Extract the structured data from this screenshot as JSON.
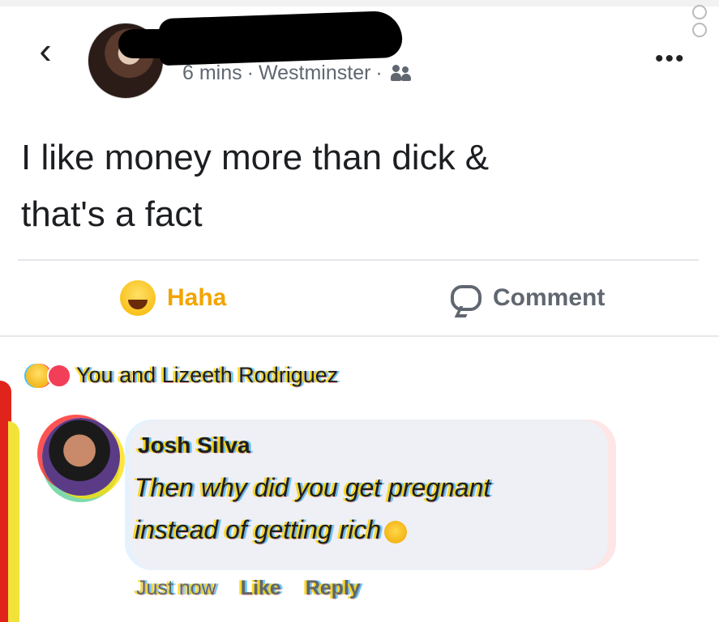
{
  "header": {
    "back_icon": "chevron-left-icon",
    "meta_time": "6 mins",
    "meta_sep": "·",
    "meta_location": "Westminster",
    "meta_sep2": "·",
    "audience_icon": "friends-icon",
    "more_label": "•••"
  },
  "post": {
    "text_line1": "I like money more than dick &",
    "text_line2": "that's a fact"
  },
  "actions": {
    "reaction_label": "Haha",
    "reaction_color": "#f2a400",
    "comment_label": "Comment"
  },
  "reactions": {
    "summary": "You and Lizeeth Rodriguez"
  },
  "comment": {
    "author": "Josh Silva",
    "text_line1": "Then why did you get pregnant",
    "text_line2": "instead of getting rich",
    "time": "Just now",
    "like_label": "Like",
    "reply_label": "Reply"
  }
}
